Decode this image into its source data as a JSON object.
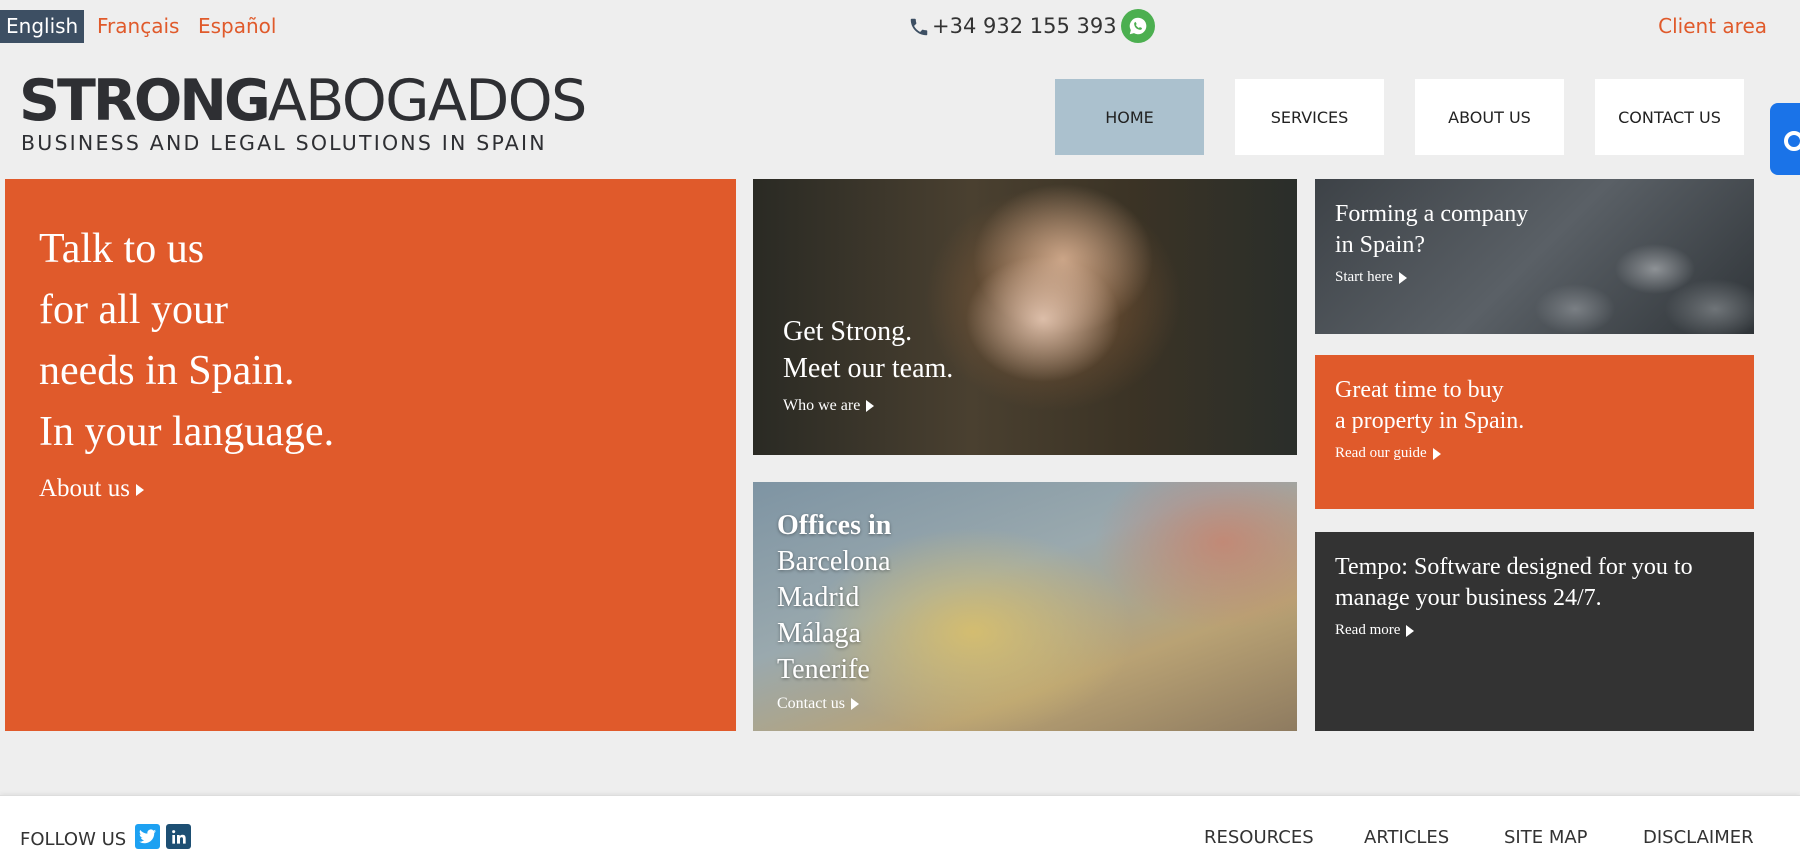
{
  "languages": [
    {
      "label": "English",
      "active": true
    },
    {
      "label": "Français",
      "active": false
    },
    {
      "label": "Español",
      "active": false
    }
  ],
  "contact": {
    "phone": "+34 932 155 393",
    "client_area": "Client area"
  },
  "logo": {
    "bold": "STRONG",
    "light": "ABOGADOS",
    "tagline": "BUSINESS AND LEGAL SOLUTIONS IN SPAIN"
  },
  "nav": [
    {
      "label": "HOME",
      "active": true
    },
    {
      "label": "SERVICES",
      "active": false
    },
    {
      "label": "ABOUT US",
      "active": false
    },
    {
      "label": "CONTACT US",
      "active": false
    }
  ],
  "tiles": {
    "main": {
      "lines": [
        "Talk to us",
        "for all your",
        "needs in Spain.",
        "In your language."
      ],
      "link": "About us"
    },
    "team": {
      "lines": [
        "Get Strong.",
        "Meet our team."
      ],
      "link": "Who we are"
    },
    "offices": {
      "heading": "Offices in",
      "cities": [
        "Barcelona",
        "Madrid",
        "Málaga",
        "Tenerife"
      ],
      "link": "Contact us"
    },
    "company": {
      "lines": [
        "Forming a company",
        "in Spain?"
      ],
      "link": "Start here"
    },
    "property": {
      "lines": [
        "Great time to buy",
        "a property in Spain."
      ],
      "link": "Read our guide"
    },
    "tempo": {
      "lines": [
        "Tempo: Software designed for you to",
        "manage your business 24/7."
      ],
      "link": "Read more"
    }
  },
  "footer": {
    "follow": "FOLLOW US",
    "social": [
      "twitter-icon",
      "linkedin-icon"
    ],
    "links": [
      "RESOURCES",
      "ARTICLES",
      "SITE MAP",
      "DISCLAIMER"
    ]
  },
  "colors": {
    "accent": "#e05a2b",
    "nav_active": "#abc1ce",
    "dark_tile": "#333333",
    "lang_active_bg": "#3d4f63"
  }
}
